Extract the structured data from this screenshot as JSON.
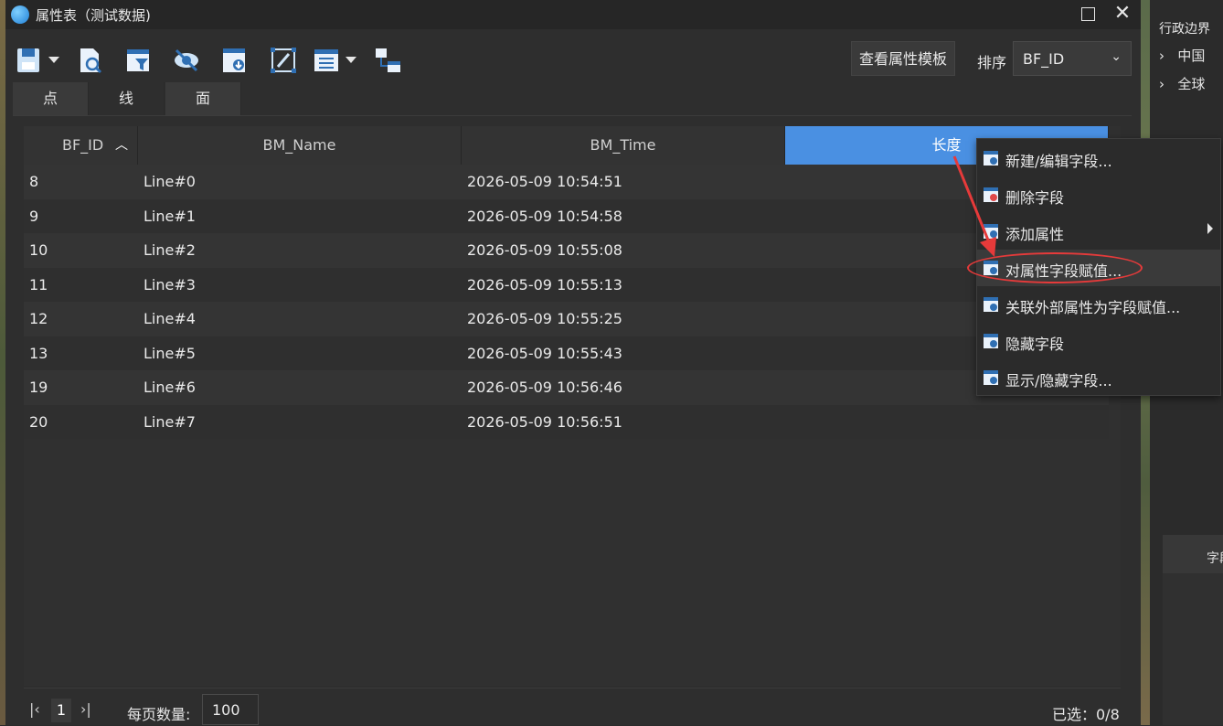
{
  "window": {
    "title": "属性表（测试数据)",
    "maximize_icon": "maximize-icon",
    "close_icon": "close-icon",
    "close_glyph": "✕"
  },
  "toolbar": {
    "icons": [
      "save-icon",
      "find-icon",
      "filter-icon",
      "hide-eye-icon",
      "export-icon",
      "edit-frame-icon",
      "list-menu-icon",
      "link-boxes-icon"
    ],
    "template_button": "查看属性模板",
    "sort_label": "排序",
    "sort_value": "BF_ID",
    "sort_chevron": "⌄"
  },
  "tabs": [
    {
      "label": "点",
      "active": false
    },
    {
      "label": "线",
      "active": true
    },
    {
      "label": "面",
      "active": false
    }
  ],
  "table": {
    "columns": [
      "BF_ID",
      "BM_Name",
      "BM_Time",
      "长度"
    ],
    "sort_indicator": "︿",
    "rows": [
      {
        "id": "8",
        "name": "Line#0",
        "time": "2026-05-09 10:54:51"
      },
      {
        "id": "9",
        "name": "Line#1",
        "time": "2026-05-09 10:54:58"
      },
      {
        "id": "10",
        "name": "Line#2",
        "time": "2026-05-09 10:55:08"
      },
      {
        "id": "11",
        "name": "Line#3",
        "time": "2026-05-09 10:55:13"
      },
      {
        "id": "12",
        "name": "Line#4",
        "time": "2026-05-09 10:55:25"
      },
      {
        "id": "13",
        "name": "Line#5",
        "time": "2026-05-09 10:55:43"
      },
      {
        "id": "19",
        "name": "Line#6",
        "time": "2026-05-09 10:56:46"
      },
      {
        "id": "20",
        "name": "Line#7",
        "time": "2026-05-09 10:56:51"
      }
    ]
  },
  "footer": {
    "first_glyph": "|‹",
    "page": "1",
    "last_glyph": "›|",
    "per_page_label": "每页数量:",
    "per_page_value": "100",
    "selected": "已选：0/8"
  },
  "right_panel": {
    "title": "行政边界",
    "items": [
      "中国",
      "全球"
    ],
    "chevron": "›",
    "lower_label": "字段"
  },
  "context_menu": {
    "items": [
      {
        "label": "新建/编辑字段...",
        "icon": "new-field-icon",
        "submenu": false
      },
      {
        "label": "删除字段",
        "icon": "delete-field-icon",
        "submenu": false
      },
      {
        "label": "添加属性",
        "icon": "add-attribute-icon",
        "submenu": true
      },
      {
        "label": "对属性字段赋值...",
        "icon": "assign-field-icon",
        "submenu": false
      },
      {
        "label": "关联外部属性为字段赋值...",
        "icon": "link-assign-icon",
        "submenu": false
      },
      {
        "label": "隐藏字段",
        "icon": "hide-field-icon",
        "submenu": false
      },
      {
        "label": "显示/隐藏字段...",
        "icon": "show-hide-field-icon",
        "submenu": false
      }
    ]
  },
  "colors": {
    "accent": "#4a90e2",
    "annotation": "#e63a3a",
    "highlight": "#c8be28"
  }
}
